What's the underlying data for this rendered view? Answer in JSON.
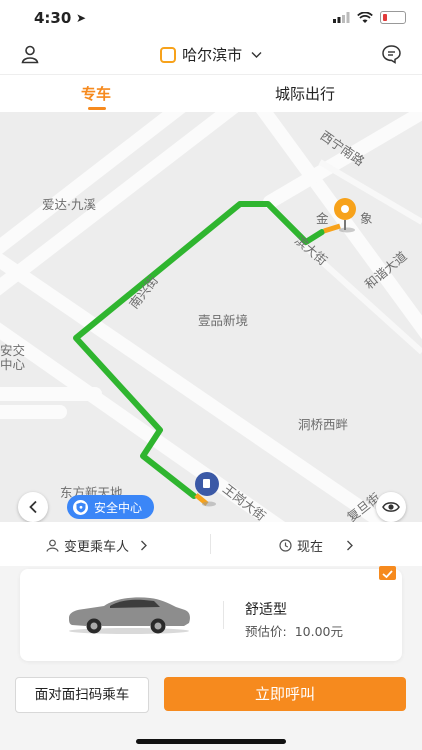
{
  "status": {
    "time": "4:30"
  },
  "header": {
    "city": "哈尔滨市"
  },
  "tabs": [
    {
      "label": "专车",
      "active": true
    },
    {
      "label": "城际出行",
      "active": false
    }
  ],
  "map": {
    "labels": [
      "西宁南路",
      "爱达·九溪",
      "金",
      "象",
      "滨大街",
      "和谐大道",
      "南兴街",
      "壹品新境",
      "安交",
      "中心",
      "洞桥西畔",
      "东方新天地",
      "王岗大街",
      "复旦街"
    ],
    "safety_label": "安全中心"
  },
  "options": {
    "passenger": "变更乘车人",
    "time": "现在"
  },
  "car": {
    "name": "舒适型",
    "price_label": "预估价:",
    "price": "10.00元"
  },
  "buttons": {
    "scan": "面对面扫码乘车",
    "call": "立即呼叫"
  },
  "colors": {
    "accent": "#f68a1e",
    "route": "#2fb52f",
    "safety": "#3b86f7"
  },
  "icons": [
    "navigation-arrow-icon",
    "signal-icon",
    "wifi-icon",
    "battery-icon",
    "user-icon",
    "city-logo-icon",
    "chevron-down-icon",
    "message-icon",
    "back-icon",
    "shield-icon",
    "locate-icon",
    "person-icon",
    "clock-icon",
    "chevron-right-icon",
    "check-icon"
  ]
}
